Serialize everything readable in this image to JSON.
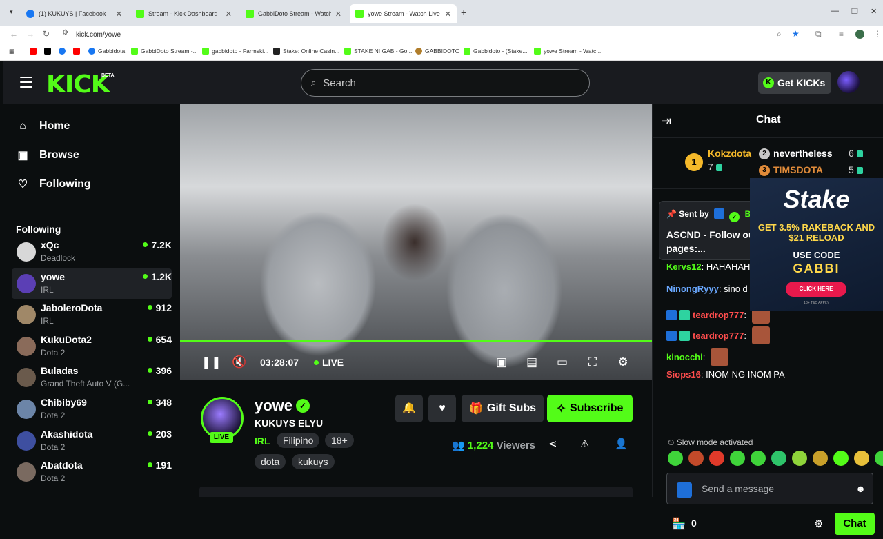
{
  "browser": {
    "tabs": [
      {
        "title": "(1) KUKUYS | Facebook",
        "color": "#1877f2"
      },
      {
        "title": "Stream - Kick Dashboard",
        "color": "#53fc18"
      },
      {
        "title": "GabbiDoto Stream - Watch Live",
        "color": "#53fc18"
      },
      {
        "title": "yowe Stream - Watch Live on K",
        "color": "#53fc18"
      }
    ],
    "url": "kick.com/yowe",
    "bookmarks": [
      "Gabbidota",
      "GabbiDoto Stream -...",
      "gabbidoto - Farmski...",
      "Stake: Online Casin...",
      "STAKE NI GAB - Go...",
      "GABBIDOTO",
      "Gabbidoto - (Stake...",
      "yowe Stream - Watc..."
    ]
  },
  "header": {
    "logo": "KICK",
    "beta": "BETA",
    "search_placeholder": "Search",
    "get_kicks": "Get KICKs"
  },
  "sidebar": {
    "nav": [
      {
        "label": "Home",
        "icon": "home-icon"
      },
      {
        "label": "Browse",
        "icon": "browse-icon"
      },
      {
        "label": "Following",
        "icon": "heart-icon"
      }
    ],
    "following_heading": "Following",
    "channels": [
      {
        "name": "xQc",
        "category": "Deadlock",
        "viewers": "7.2K",
        "color": "#d8d8d8"
      },
      {
        "name": "yowe",
        "category": "IRL",
        "viewers": "1.2K",
        "color": "#5b3fb5"
      },
      {
        "name": "JaboleroDota",
        "category": "IRL",
        "viewers": "912",
        "color": "#a08868"
      },
      {
        "name": "KukuDota2",
        "category": "Dota 2",
        "viewers": "654",
        "color": "#8a6b5a"
      },
      {
        "name": "Buladas",
        "category": "Grand Theft Auto V (G...",
        "viewers": "396",
        "color": "#6a5a4c"
      },
      {
        "name": "Chibiby69",
        "category": "Dota 2",
        "viewers": "348",
        "color": "#6c85a8"
      },
      {
        "name": "Akashidota",
        "category": "Dota 2",
        "viewers": "203",
        "color": "#3e4fa0"
      },
      {
        "name": "Abatdota",
        "category": "Dota 2",
        "viewers": "191",
        "color": "#7a6a60"
      }
    ]
  },
  "player": {
    "time": "03:28:07",
    "live_label": "LIVE",
    "progress": 1.0
  },
  "stream": {
    "streamer": "yowe",
    "live_badge": "LIVE",
    "title": "KUKUYS ELYU",
    "category": "IRL",
    "tags": [
      "Filipino",
      "18+",
      "dota",
      "kukuys"
    ],
    "gift_subs": "Gift Subs",
    "subscribe": "Subscribe",
    "viewer_count": "1,224",
    "viewers_label": "Viewers"
  },
  "chat": {
    "title": "Chat",
    "leaderboard": [
      {
        "rank": "1",
        "name": "Kokzdota",
        "count": "7",
        "color": "#f5b92a"
      },
      {
        "rank": "2",
        "name": "nevertheless",
        "count": "6",
        "color": "#c8c8c8"
      },
      {
        "rank": "3",
        "name": "TIMSDOTA",
        "count": "5",
        "color": "#e08b3a"
      }
    ],
    "pinned": {
      "sent_by": "Sent by",
      "bot_name": "Bot",
      "text": "ASCND - Follow our pages:..."
    },
    "messages": [
      {
        "user": "Kervs12",
        "text": "HAHAHAH",
        "color": "#53fc18"
      },
      {
        "user": "NinongRyyy",
        "text": "sino d",
        "color": "#6aa8ff"
      },
      {
        "user": "teardrop777",
        "text": "",
        "color": "#ff4d4d"
      },
      {
        "user": "teardrop777",
        "text": "",
        "color": "#ff4d4d"
      },
      {
        "user": "kinocchi",
        "text": "",
        "color": "#53fc18"
      },
      {
        "user": "Siops16",
        "text": "INOM NG INOM PA",
        "color": "#ff4d4d"
      }
    ],
    "ad": {
      "brand": "Stake",
      "line1": "GET 3.5% RAKEBACK AND $21 RELOAD",
      "line2": "USE CODE",
      "code": "GABBI",
      "button": "CLICK HERE",
      "fine": "18+ T&C APPLY"
    },
    "slow_mode": "Slow mode activated",
    "input_placeholder": "Send a message",
    "kicks_count": "0",
    "send_label": "Chat"
  }
}
